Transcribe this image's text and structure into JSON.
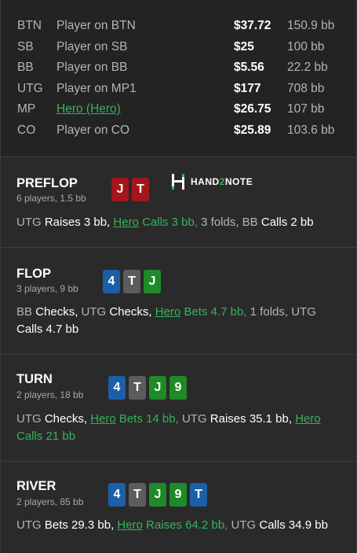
{
  "players": [
    {
      "pos": "BTN",
      "name": "Player on BTN",
      "stack": "$37.72",
      "bb": "150.9 bb"
    },
    {
      "pos": "SB",
      "name": "Player on SB",
      "stack": "$25",
      "bb": "100 bb"
    },
    {
      "pos": "BB",
      "name": "Player on BB",
      "stack": "$5.56",
      "bb": "22.2 bb"
    },
    {
      "pos": "UTG",
      "name": "Player on MP1",
      "stack": "$177",
      "bb": "708 bb"
    },
    {
      "pos": "MP",
      "name": "Hero (Hero)",
      "stack": "$26.75",
      "bb": "107 bb"
    },
    {
      "pos": "CO",
      "name": "Player on CO",
      "stack": "$25.89",
      "bb": "103.6 bb"
    }
  ],
  "logo": {
    "icon": "hand2note-logo-icon",
    "text_a": "HAND",
    "text_b": "2",
    "text_c": "NOTE"
  },
  "colors": {
    "hero": "#35b35b",
    "card_red": "#a3161b",
    "card_blue": "#1a5fa8",
    "card_grey": "#5c5c5c",
    "card_green": "#1e8a28"
  },
  "streets": {
    "preflop": {
      "name": "PREFLOP",
      "sub": "6 players, 1.5 bb",
      "cards": [
        "J",
        "T"
      ],
      "actions": {
        "a1": "UTG",
        "a2": "Raises 3 bb,",
        "a3": "Hero",
        "a4": "Calls 3 bb,",
        "a5": "3 folds, BB",
        "a6": "Calls 2 bb"
      }
    },
    "flop": {
      "name": "FLOP",
      "sub": "3 players, 9 bb",
      "cards": [
        "4",
        "T",
        "J"
      ],
      "actions": {
        "a1": "BB",
        "a2": "Checks,",
        "a3": "UTG",
        "a4": "Checks,",
        "a5": "Hero",
        "a6": "Bets 4.7 bb,",
        "a7": "1 folds, UTG",
        "a8": "Calls 4.7 bb"
      }
    },
    "turn": {
      "name": "TURN",
      "sub": "2 players, 18 bb",
      "cards": [
        "4",
        "T",
        "J",
        "9"
      ],
      "actions": {
        "a1": "UTG",
        "a2": "Checks,",
        "a3": "Hero",
        "a4": "Bets 14 bb,",
        "a5": "UTG",
        "a6": "Raises 35.1 bb,",
        "a7": "Hero",
        "a8": "Calls 21 bb"
      }
    },
    "river": {
      "name": "RIVER",
      "sub": "2 players, 85 bb",
      "cards": [
        "4",
        "T",
        "J",
        "9",
        "T"
      ],
      "actions": {
        "a1": "UTG",
        "a2": "Bets 29.3 bb,",
        "a3": "Hero",
        "a4": "Raises 64.2 bb,",
        "a5": "UTG",
        "a6": "Calls 34.9 bb"
      }
    }
  }
}
